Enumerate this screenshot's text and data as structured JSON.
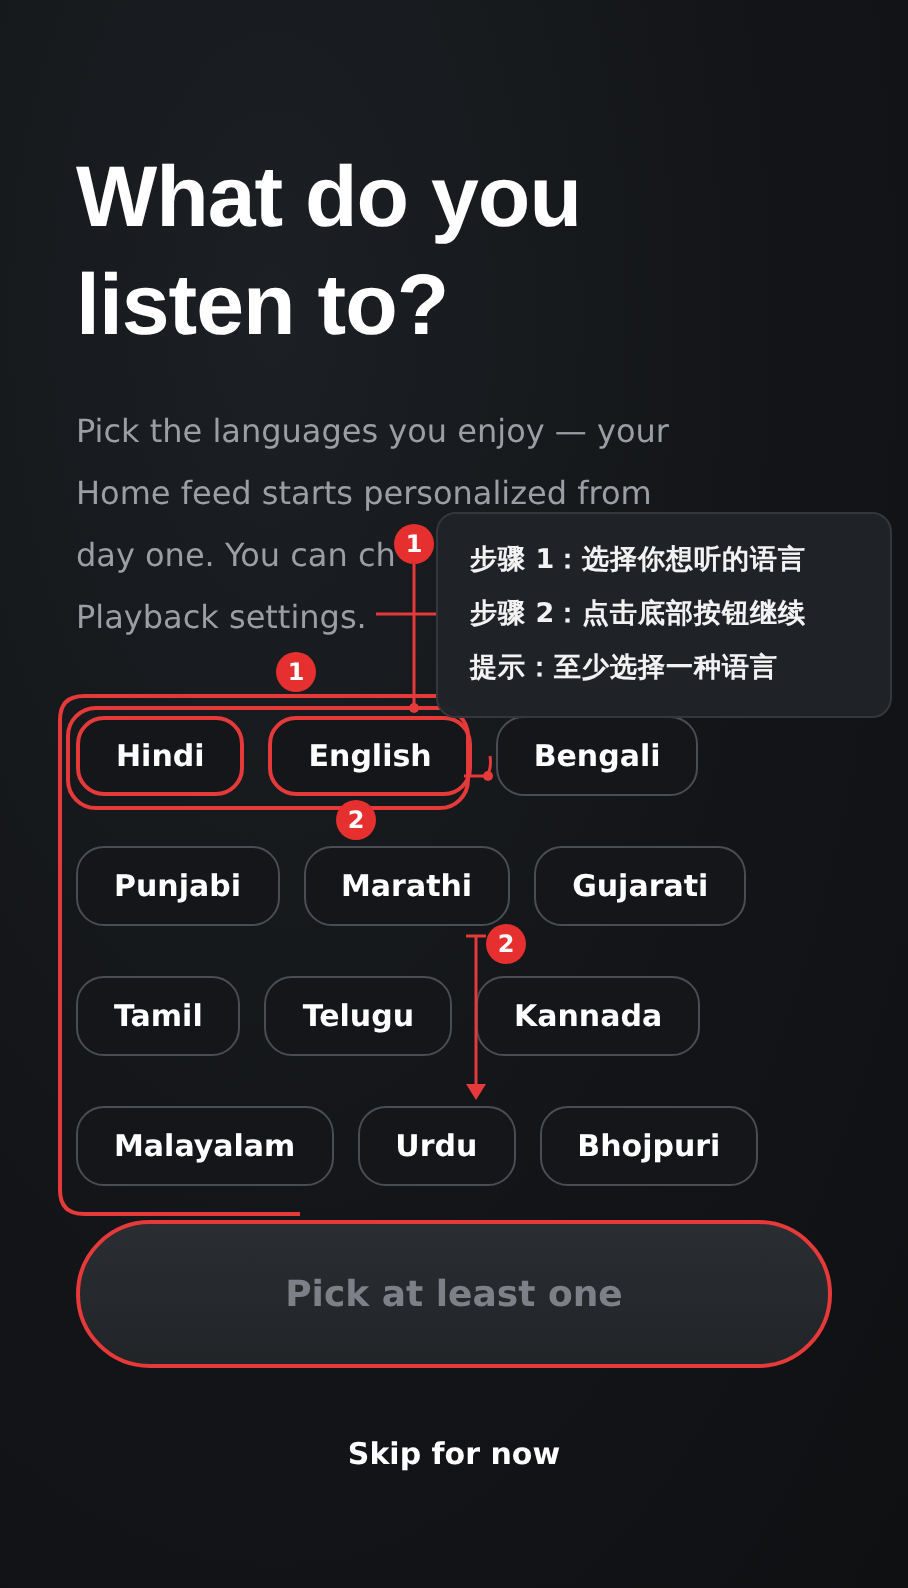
{
  "heading": {
    "text": "What do you listen to?"
  },
  "intro": {
    "lines": [
      "Pick the languages you enjoy — your",
      "Home feed starts personalized from",
      "day one. You can ch",
      "Playback settings."
    ]
  },
  "languages": [
    {
      "label": "Hindi",
      "highlighted": true
    },
    {
      "label": "English",
      "highlighted": true
    },
    {
      "label": "Bengali",
      "highlighted": false
    },
    {
      "label": "Punjabi",
      "highlighted": false
    },
    {
      "label": "Marathi",
      "highlighted": false
    },
    {
      "label": "Gujarati",
      "highlighted": false
    },
    {
      "label": "Tamil",
      "highlighted": false
    },
    {
      "label": "Telugu",
      "highlighted": false
    },
    {
      "label": "Kannada",
      "highlighted": false
    },
    {
      "label": "Malayalam",
      "highlighted": false
    },
    {
      "label": "Urdu",
      "highlighted": false
    },
    {
      "label": "Bhojpuri",
      "highlighted": false
    }
  ],
  "primary_button": {
    "label": "Pick at least one",
    "disabled": true,
    "highlighted": true
  },
  "secondary_link": {
    "label": "Skip for now"
  },
  "annotations": {
    "badges": [
      {
        "label": "1"
      },
      {
        "label": "1"
      },
      {
        "label": "2"
      },
      {
        "label": "2"
      }
    ],
    "tooltip": {
      "lines": [
        "步骤 1：选择你想听的语言",
        "步骤 2：点击底部按钮继续",
        "提示：至少选择一种语言"
      ]
    }
  }
}
